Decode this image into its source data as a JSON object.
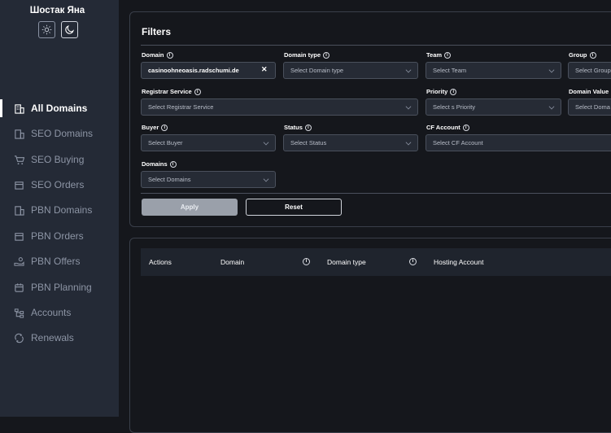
{
  "user": {
    "name": "Шостак Яна"
  },
  "theme": {
    "light_icon": "sun-icon",
    "dark_icon": "moon-icon"
  },
  "nav": [
    {
      "label": "All Domains",
      "icon": "building-icon",
      "active": true
    },
    {
      "label": "SEO Domains",
      "icon": "building-icon"
    },
    {
      "label": "SEO Buying",
      "icon": "cart-icon"
    },
    {
      "label": "SEO Orders",
      "icon": "box-icon"
    },
    {
      "label": "PBN Domains",
      "icon": "building-icon"
    },
    {
      "label": "PBN Orders",
      "icon": "box-icon"
    },
    {
      "label": "PBN Offers",
      "icon": "hand-coins-icon"
    },
    {
      "label": "PBN Planning",
      "icon": "calendar-icon"
    },
    {
      "label": "Accounts",
      "icon": "network-icon"
    },
    {
      "label": "Renewals",
      "icon": "refresh-icon"
    }
  ],
  "filters": {
    "title": "Filters",
    "domain": {
      "label": "Domain",
      "value": "casinoohneoasis.radschumi.de"
    },
    "domain_type": {
      "label": "Domain type",
      "placeholder": "Select Domain type"
    },
    "team": {
      "label": "Team",
      "placeholder": "Select Team"
    },
    "group": {
      "label": "Group",
      "placeholder": "Select Group"
    },
    "registrar": {
      "label": "Registrar Service",
      "placeholder": "Select Registrar Service"
    },
    "priority": {
      "label": "Priority",
      "placeholder": "Select s Priority"
    },
    "domain_value": {
      "label": "Domain Value",
      "placeholder": "Select Doma"
    },
    "buyer": {
      "label": "Buyer",
      "placeholder": "Select Buyer"
    },
    "status": {
      "label": "Status",
      "placeholder": "Select Status"
    },
    "cf_account": {
      "label": "CF Account",
      "placeholder": "Select CF Account"
    },
    "domains": {
      "label": "Domains",
      "placeholder": "Select Domains"
    },
    "apply_label": "Apply",
    "reset_label": "Reset"
  },
  "table": {
    "columns": [
      "Actions",
      "Domain",
      "Domain type",
      "Hosting Account"
    ]
  }
}
